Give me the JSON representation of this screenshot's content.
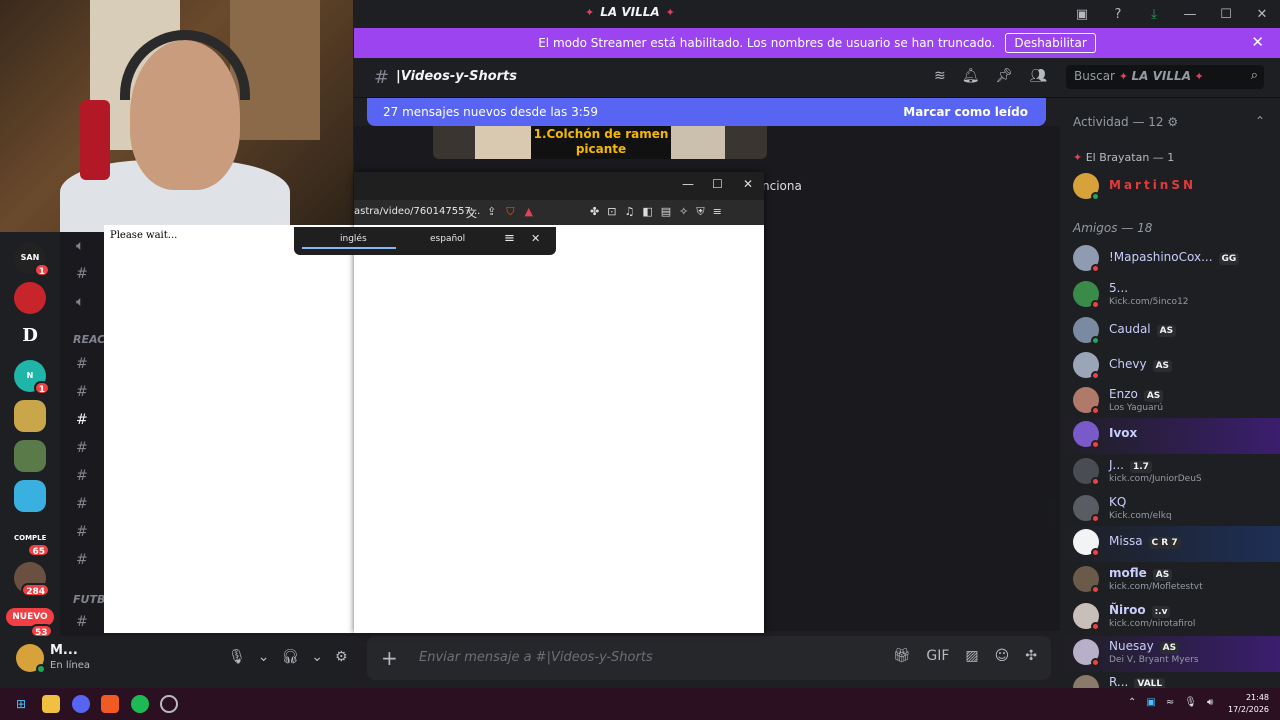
{
  "titlebar": {
    "title": "LA VILLA",
    "icons": [
      "inbox-icon",
      "help-icon",
      "download-icon",
      "minimize-icon",
      "maximize-icon",
      "close-icon"
    ]
  },
  "banner": {
    "text": "El modo Streamer está habilitado. Los nombres de usuario se han truncado.",
    "button": "Deshabilitar"
  },
  "header": {
    "channel": "|Videos-y-Shorts",
    "search_placeholder": "Buscar",
    "search_server": "LA VILLA"
  },
  "new_messages": {
    "text": "27 mensajes nuevos desde las 3:59",
    "action": "Marcar como leído"
  },
  "chat": {
    "thumb_text": "1.Colchón de ramen picante",
    "fragment": "nciona"
  },
  "composer": {
    "placeholder": "Enviar mensaje a #|Videos-y-Shorts"
  },
  "members": {
    "activity_header": "Actividad — 12",
    "brayatan_header": "El Brayatan — 1",
    "amigos_header": "Amigos — 18",
    "list": [
      {
        "name": "MartinSN",
        "sub": "",
        "tag": ""
      },
      {
        "name": "!MapashinoCox...",
        "sub": "",
        "tag": "GG"
      },
      {
        "name": "5...",
        "sub": "Kick.com/5inco12",
        "tag": ""
      },
      {
        "name": "Caudal",
        "sub": "",
        "tag": "AS"
      },
      {
        "name": "Chevy",
        "sub": "",
        "tag": "AS"
      },
      {
        "name": "Enzo",
        "sub": "Los Yaguarú",
        "tag": "AS"
      },
      {
        "name": "Ivox",
        "sub": "",
        "tag": ""
      },
      {
        "name": "J...",
        "sub": "kick.com/JuniorDeuS",
        "tag": "1.7"
      },
      {
        "name": "KQ",
        "sub": "Kick.com/elkq",
        "tag": ""
      },
      {
        "name": "Missa",
        "sub": "",
        "tag": "C R 7"
      },
      {
        "name": "mofle",
        "sub": "kick.com/Mofletestvt",
        "tag": "AS"
      },
      {
        "name": "Ñiroo",
        "sub": "kick.com/nirotafirol",
        "tag": ":.v"
      },
      {
        "name": "Nuesay",
        "sub": "Dei V, Bryant Myers",
        "tag": "AS"
      },
      {
        "name": "R...",
        "sub": "",
        "tag": "VALL"
      }
    ]
  },
  "guilds": {
    "items": [
      {
        "label": "SAN",
        "badge": "1"
      },
      {
        "label": "",
        "badge": ""
      },
      {
        "label": "D",
        "badge": ""
      },
      {
        "label": "N",
        "badge": "1"
      },
      {
        "label": "",
        "badge": ""
      },
      {
        "label": "",
        "badge": ""
      },
      {
        "label": "",
        "badge": ""
      },
      {
        "label": "COMPLEX",
        "badge": "65"
      },
      {
        "label": "",
        "badge": "284"
      }
    ],
    "nuevo": "NUEVO",
    "last_badge": "53"
  },
  "channels": {
    "cat1": "REAC",
    "cat2": "FUTB"
  },
  "user": {
    "name": "M...",
    "status": "En línea"
  },
  "browser": {
    "url": "astra/video/760147557...",
    "wait": "Please wait...",
    "lang1": "inglés",
    "lang2": "español"
  },
  "taskbar": {
    "time": "21:48",
    "date": "17/2/2026"
  }
}
